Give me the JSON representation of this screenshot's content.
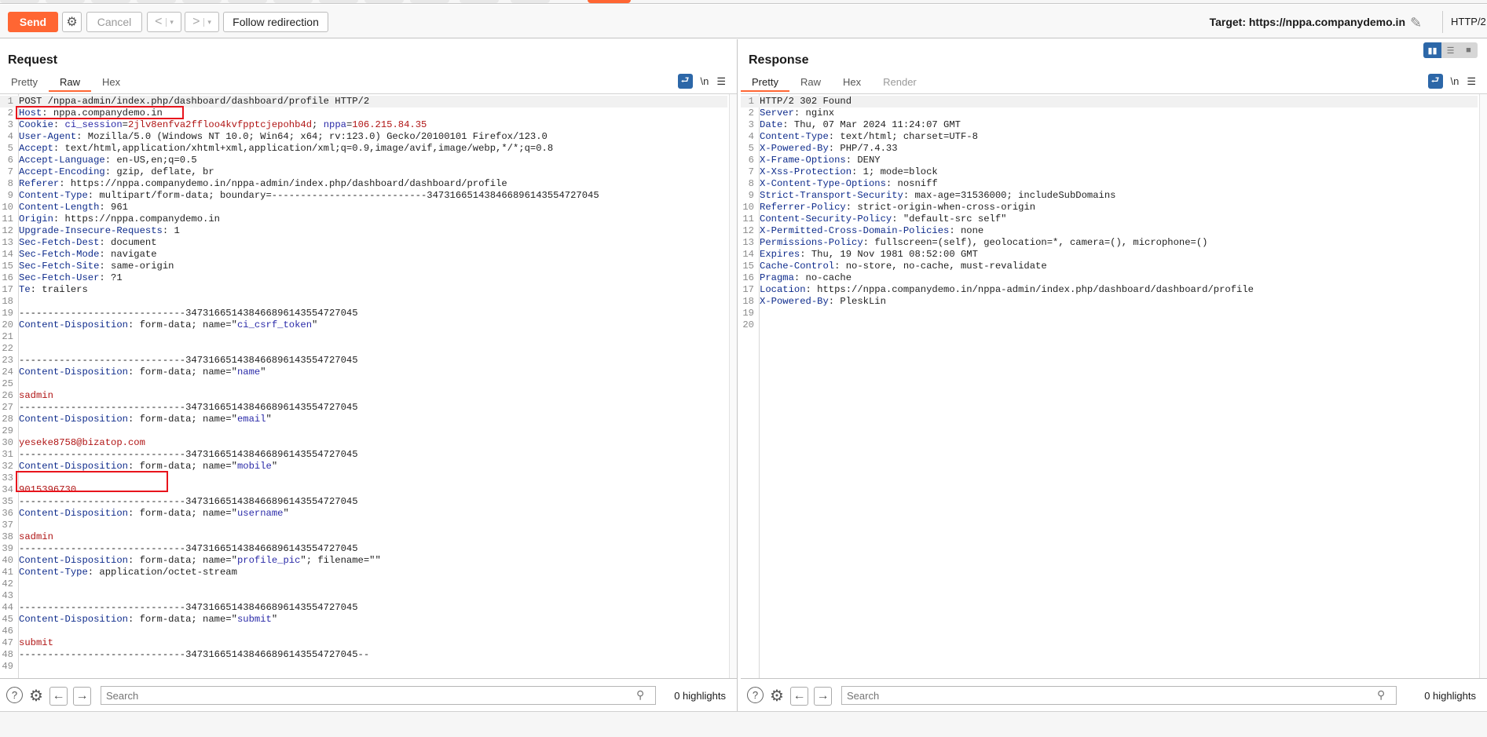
{
  "toolbar": {
    "send_label": "Send",
    "cancel_label": "Cancel",
    "back_label": "<",
    "forward_label": ">",
    "dropdown_glyph": "▾",
    "follow_label": "Follow redirection",
    "target_label": "Target: https://nppa.companydemo.in",
    "http_version": "HTTP/2",
    "accent_color": "#ff6633"
  },
  "request": {
    "title": "Request",
    "tabs": [
      {
        "label": "Pretty",
        "active": false
      },
      {
        "label": "Raw",
        "active": true
      },
      {
        "label": "Hex",
        "active": false
      }
    ],
    "icons": {
      "wrap": "word-wrap-icon",
      "newline": "\\n",
      "menu": "menu-icon"
    },
    "lines": [
      [
        [
          "hv",
          "POST /nppa-admin/index.php/dashboard/dashboard/profile HTTP/2"
        ]
      ],
      [
        [
          "hk",
          "Host"
        ],
        [
          "hv",
          ": nppa.companydemo.in"
        ]
      ],
      [
        [
          "hk",
          "Cookie"
        ],
        [
          "hv",
          ": "
        ],
        [
          "bl",
          "ci_session"
        ],
        [
          "hv",
          "="
        ],
        [
          "rv",
          "2jlv8enfva2ffloo4kvfpptcjepohb4d"
        ],
        [
          "hv",
          "; "
        ],
        [
          "bl",
          "nppa"
        ],
        [
          "hv",
          "="
        ],
        [
          "rv",
          "106.215.84.35"
        ]
      ],
      [
        [
          "hk",
          "User-Agent"
        ],
        [
          "hv",
          ": Mozilla/5.0 (Windows NT 10.0; Win64; x64; rv:123.0) Gecko/20100101 Firefox/123.0"
        ]
      ],
      [
        [
          "hk",
          "Accept"
        ],
        [
          "hv",
          ": text/html,application/xhtml+xml,application/xml;q=0.9,image/avif,image/webp,*/*;q=0.8"
        ]
      ],
      [
        [
          "hk",
          "Accept-Language"
        ],
        [
          "hv",
          ": en-US,en;q=0.5"
        ]
      ],
      [
        [
          "hk",
          "Accept-Encoding"
        ],
        [
          "hv",
          ": gzip, deflate, br"
        ]
      ],
      [
        [
          "hk",
          "Referer"
        ],
        [
          "hv",
          ": https://nppa.companydemo.in/nppa-admin/index.php/dashboard/dashboard/profile"
        ]
      ],
      [
        [
          "hk",
          "Content-Type"
        ],
        [
          "hv",
          ": multipart/form-data; boundary=---------------------------347316651438466896143554727045"
        ]
      ],
      [
        [
          "hk",
          "Content-Length"
        ],
        [
          "hv",
          ": 961"
        ]
      ],
      [
        [
          "hk",
          "Origin"
        ],
        [
          "hv",
          ": https://nppa.companydemo.in"
        ]
      ],
      [
        [
          "hk",
          "Upgrade-Insecure-Requests"
        ],
        [
          "hv",
          ": 1"
        ]
      ],
      [
        [
          "hk",
          "Sec-Fetch-Dest"
        ],
        [
          "hv",
          ": document"
        ]
      ],
      [
        [
          "hk",
          "Sec-Fetch-Mode"
        ],
        [
          "hv",
          ": navigate"
        ]
      ],
      [
        [
          "hk",
          "Sec-Fetch-Site"
        ],
        [
          "hv",
          ": same-origin"
        ]
      ],
      [
        [
          "hk",
          "Sec-Fetch-User"
        ],
        [
          "hv",
          ": ?1"
        ]
      ],
      [
        [
          "hk",
          "Te"
        ],
        [
          "hv",
          ": trailers"
        ]
      ],
      [],
      [
        [
          "hv",
          "-----------------------------347316651438466896143554727045"
        ]
      ],
      [
        [
          "hk",
          "Content-Disposition"
        ],
        [
          "hv",
          ": form-data; name=\""
        ],
        [
          "bl",
          "ci_csrf_token"
        ],
        [
          "hv",
          "\""
        ]
      ],
      [],
      [],
      [
        [
          "hv",
          "-----------------------------347316651438466896143554727045"
        ]
      ],
      [
        [
          "hk",
          "Content-Disposition"
        ],
        [
          "hv",
          ": form-data; name=\""
        ],
        [
          "bl",
          "name"
        ],
        [
          "hv",
          "\""
        ]
      ],
      [],
      [
        [
          "rv",
          "sadmin"
        ]
      ],
      [
        [
          "hv",
          "-----------------------------347316651438466896143554727045"
        ]
      ],
      [
        [
          "hk",
          "Content-Disposition"
        ],
        [
          "hv",
          ": form-data; name=\""
        ],
        [
          "bl",
          "email"
        ],
        [
          "hv",
          "\""
        ]
      ],
      [],
      [
        [
          "rv",
          "yeseke8758@bizatop.com"
        ]
      ],
      [
        [
          "hv",
          "-----------------------------347316651438466896143554727045"
        ]
      ],
      [
        [
          "hk",
          "Content-Disposition"
        ],
        [
          "hv",
          ": form-data; name=\""
        ],
        [
          "bl",
          "mobile"
        ],
        [
          "hv",
          "\""
        ]
      ],
      [],
      [
        [
          "rv",
          "9015396730"
        ]
      ],
      [
        [
          "hv",
          "-----------------------------347316651438466896143554727045"
        ]
      ],
      [
        [
          "hk",
          "Content-Disposition"
        ],
        [
          "hv",
          ": form-data; name=\""
        ],
        [
          "bl",
          "username"
        ],
        [
          "hv",
          "\""
        ]
      ],
      [],
      [
        [
          "rv",
          "sadmin"
        ]
      ],
      [
        [
          "hv",
          "-----------------------------347316651438466896143554727045"
        ]
      ],
      [
        [
          "hk",
          "Content-Disposition"
        ],
        [
          "hv",
          ": form-data; name=\""
        ],
        [
          "bl",
          "profile_pic"
        ],
        [
          "hv",
          "\"; filename=\"\""
        ]
      ],
      [
        [
          "hk",
          "Content-Type"
        ],
        [
          "hv",
          ": application/octet-stream"
        ]
      ],
      [],
      [],
      [
        [
          "hv",
          "-----------------------------347316651438466896143554727045"
        ]
      ],
      [
        [
          "hk",
          "Content-Disposition"
        ],
        [
          "hv",
          ": form-data; name=\""
        ],
        [
          "bl",
          "submit"
        ],
        [
          "hv",
          "\""
        ]
      ],
      [],
      [
        [
          "rv",
          "submit"
        ]
      ],
      [
        [
          "hv",
          "-----------------------------347316651438466896143554727045--"
        ]
      ],
      []
    ],
    "highlighted_lines": [
      2,
      30
    ],
    "search_placeholder": "Search",
    "highlights_label": "0 highlights"
  },
  "response": {
    "title": "Response",
    "tabs": [
      {
        "label": "Pretty",
        "active": true
      },
      {
        "label": "Raw",
        "active": false
      },
      {
        "label": "Hex",
        "active": false
      },
      {
        "label": "Render",
        "active": false,
        "disabled": true
      }
    ],
    "lines": [
      [
        [
          "hv",
          "HTTP/2 302 Found"
        ]
      ],
      [
        [
          "hk",
          "Server"
        ],
        [
          "hv",
          ": nginx"
        ]
      ],
      [
        [
          "hk",
          "Date"
        ],
        [
          "hv",
          ": Thu, 07 Mar 2024 11:24:07 GMT"
        ]
      ],
      [
        [
          "hk",
          "Content-Type"
        ],
        [
          "hv",
          ": text/html; charset=UTF-8"
        ]
      ],
      [
        [
          "hk",
          "X-Powered-By"
        ],
        [
          "hv",
          ": PHP/7.4.33"
        ]
      ],
      [
        [
          "hk",
          "X-Frame-Options"
        ],
        [
          "hv",
          ": DENY"
        ]
      ],
      [
        [
          "hk",
          "X-Xss-Protection"
        ],
        [
          "hv",
          ": 1; mode=block"
        ]
      ],
      [
        [
          "hk",
          "X-Content-Type-Options"
        ],
        [
          "hv",
          ": nosniff"
        ]
      ],
      [
        [
          "hk",
          "Strict-Transport-Security"
        ],
        [
          "hv",
          ": max-age=31536000; includeSubDomains"
        ]
      ],
      [
        [
          "hk",
          "Referrer-Policy"
        ],
        [
          "hv",
          ": strict-origin-when-cross-origin"
        ]
      ],
      [
        [
          "hk",
          "Content-Security-Policy"
        ],
        [
          "hv",
          ": \"default-src self\""
        ]
      ],
      [
        [
          "hk",
          "X-Permitted-Cross-Domain-Policies"
        ],
        [
          "hv",
          ": none"
        ]
      ],
      [
        [
          "hk",
          "Permissions-Policy"
        ],
        [
          "hv",
          ": fullscreen=(self), geolocation=*, camera=(), microphone=()"
        ]
      ],
      [
        [
          "hk",
          "Expires"
        ],
        [
          "hv",
          ": Thu, 19 Nov 1981 08:52:00 GMT"
        ]
      ],
      [
        [
          "hk",
          "Cache-Control"
        ],
        [
          "hv",
          ": no-store, no-cache, must-revalidate"
        ]
      ],
      [
        [
          "hk",
          "Pragma"
        ],
        [
          "hv",
          ": no-cache"
        ]
      ],
      [
        [
          "hk",
          "Location"
        ],
        [
          "hv",
          ": https://nppa.companydemo.in/nppa-admin/index.php/dashboard/dashboard/profile"
        ]
      ],
      [
        [
          "hk",
          "X-Powered-By"
        ],
        [
          "hv",
          ": PleskLin"
        ]
      ],
      [],
      []
    ],
    "search_placeholder": "Search",
    "highlights_label": "0 highlights"
  },
  "layout_modes": [
    "side-by-side",
    "stacked",
    "single"
  ],
  "active_layout_mode": "side-by-side"
}
